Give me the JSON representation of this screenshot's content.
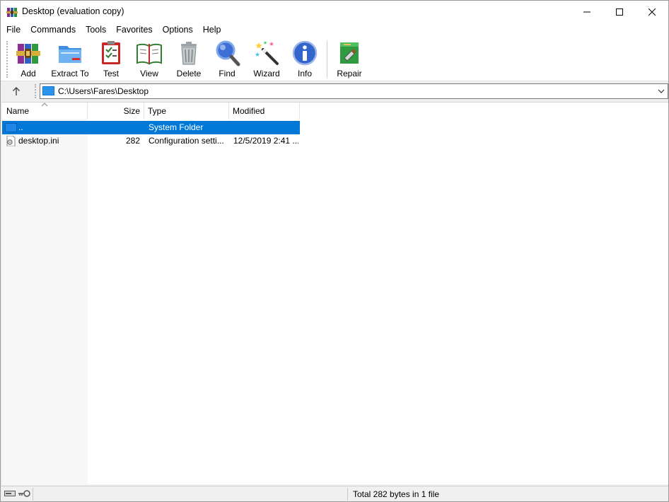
{
  "window": {
    "title": "Desktop (evaluation copy)"
  },
  "menu": [
    "File",
    "Commands",
    "Tools",
    "Favorites",
    "Options",
    "Help"
  ],
  "toolbar": {
    "add": "Add",
    "extract_to": "Extract To",
    "test": "Test",
    "view": "View",
    "delete": "Delete",
    "find": "Find",
    "wizard": "Wizard",
    "info": "Info",
    "repair": "Repair"
  },
  "address": {
    "path": "C:\\Users\\Fares\\Desktop"
  },
  "columns": {
    "name": "Name",
    "size": "Size",
    "type": "Type",
    "modified": "Modified"
  },
  "files": [
    {
      "name": "..",
      "size": "",
      "type": "System Folder",
      "modified": "",
      "selected": true
    },
    {
      "name": "desktop.ini",
      "size": "282",
      "type": "Configuration setti...",
      "modified": "12/5/2019 2:41 ...",
      "selected": false
    }
  ],
  "status": {
    "text": "Total 282 bytes in 1 file"
  },
  "colors": {
    "selection": "#0078d7",
    "accent": "#0078d7"
  }
}
